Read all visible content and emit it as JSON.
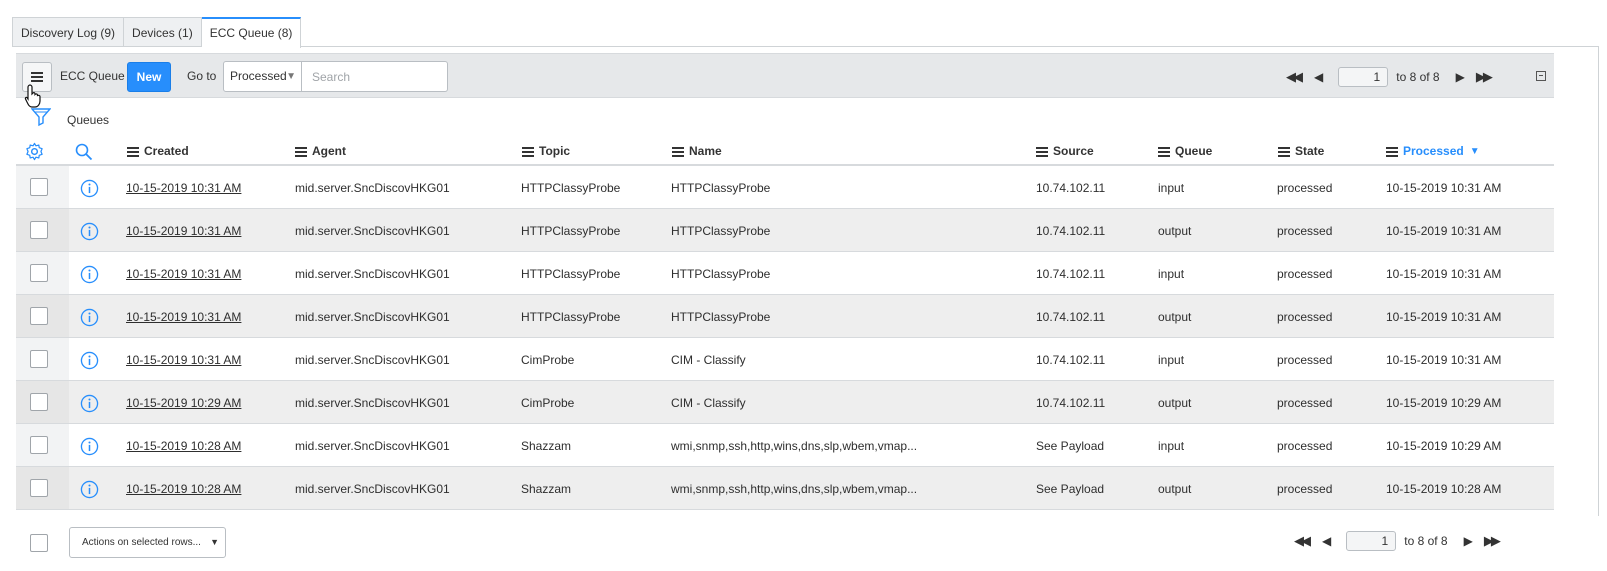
{
  "tabs": [
    {
      "label": "Discovery Log (9)"
    },
    {
      "label": "Devices (1)"
    },
    {
      "label": "ECC Queue (8)"
    }
  ],
  "toolbar": {
    "title": "ECC Queue",
    "new_label": "New",
    "goto_label": "Go to",
    "goto_value": "Processed",
    "search_placeholder": "Search"
  },
  "pager": {
    "page": "1",
    "range": "to 8 of 8"
  },
  "breadcrumb": "Queues",
  "columns": {
    "created": "Created",
    "agent": "Agent",
    "topic": "Topic",
    "name": "Name",
    "source": "Source",
    "queue": "Queue",
    "state": "State",
    "processed": "Processed"
  },
  "rows": [
    {
      "created": "10-15-2019 10:31 AM",
      "agent": "mid.server.SncDiscovHKG01",
      "topic": "HTTPClassyProbe",
      "name": "HTTPClassyProbe",
      "source": "10.74.102.11",
      "queue": "input",
      "state": "processed",
      "processed": "10-15-2019 10:31 AM"
    },
    {
      "created": "10-15-2019 10:31 AM",
      "agent": "mid.server.SncDiscovHKG01",
      "topic": "HTTPClassyProbe",
      "name": "HTTPClassyProbe",
      "source": "10.74.102.11",
      "queue": "output",
      "state": "processed",
      "processed": "10-15-2019 10:31 AM"
    },
    {
      "created": "10-15-2019 10:31 AM",
      "agent": "mid.server.SncDiscovHKG01",
      "topic": "HTTPClassyProbe",
      "name": "HTTPClassyProbe",
      "source": "10.74.102.11",
      "queue": "input",
      "state": "processed",
      "processed": "10-15-2019 10:31 AM"
    },
    {
      "created": "10-15-2019 10:31 AM",
      "agent": "mid.server.SncDiscovHKG01",
      "topic": "HTTPClassyProbe",
      "name": "HTTPClassyProbe",
      "source": "10.74.102.11",
      "queue": "output",
      "state": "processed",
      "processed": "10-15-2019 10:31 AM"
    },
    {
      "created": "10-15-2019 10:31 AM",
      "agent": "mid.server.SncDiscovHKG01",
      "topic": "CimProbe",
      "name": "CIM - Classify",
      "source": "10.74.102.11",
      "queue": "input",
      "state": "processed",
      "processed": "10-15-2019 10:31 AM"
    },
    {
      "created": "10-15-2019 10:29 AM",
      "agent": "mid.server.SncDiscovHKG01",
      "topic": "CimProbe",
      "name": "CIM - Classify",
      "source": "10.74.102.11",
      "queue": "output",
      "state": "processed",
      "processed": "10-15-2019 10:29 AM"
    },
    {
      "created": "10-15-2019 10:28 AM",
      "agent": "mid.server.SncDiscovHKG01",
      "topic": "Shazzam",
      "name": "wmi,snmp,ssh,http,wins,dns,slp,wbem,vmap...",
      "source": "See Payload",
      "queue": "input",
      "state": "processed",
      "processed": "10-15-2019 10:29 AM"
    },
    {
      "created": "10-15-2019 10:28 AM",
      "agent": "mid.server.SncDiscovHKG01",
      "topic": "Shazzam",
      "name": "wmi,snmp,ssh,http,wins,dns,slp,wbem,vmap...",
      "source": "See Payload",
      "queue": "output",
      "state": "processed",
      "processed": "10-15-2019 10:28 AM"
    }
  ],
  "footer": {
    "actions_label": "Actions on selected rows..."
  },
  "colors": {
    "accent": "#278efc",
    "alt_row": "#eeeeee"
  },
  "icons": [
    "menu-icon",
    "filter-icon",
    "gear-icon",
    "search-icon",
    "info-icon",
    "first-page-icon",
    "prev-page-icon",
    "next-page-icon",
    "last-page-icon",
    "collapse-icon"
  ]
}
